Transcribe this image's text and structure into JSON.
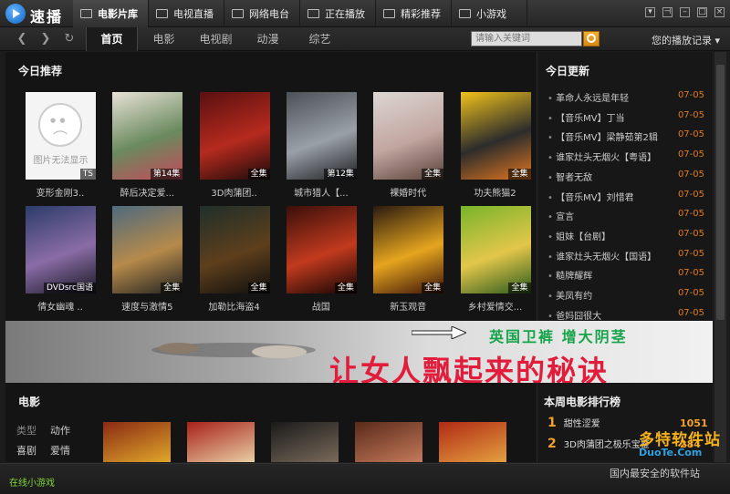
{
  "app": {
    "name": "速播"
  },
  "nav_tabs": [
    {
      "label": "电影片库",
      "active": true
    },
    {
      "label": "电视直播"
    },
    {
      "label": "网络电台"
    },
    {
      "label": "正在播放"
    },
    {
      "label": "精彩推荐"
    },
    {
      "label": "小游戏"
    }
  ],
  "toolbar": {
    "categories": [
      "首页",
      "电影",
      "电视剧",
      "动漫",
      "综艺"
    ],
    "active_category": "首页",
    "search_placeholder": "请输入关键词",
    "history_label": "您的播放记录 ▾"
  },
  "recommend": {
    "title": "今日推荐",
    "items": [
      {
        "title": "变形金刚3..",
        "badge": "TS",
        "no_image": true,
        "no_image_text": "图片无法显示"
      },
      {
        "title": "醉后决定爱...",
        "badge": "第14集",
        "colors": [
          "#e7e1d6",
          "#6a8a5e",
          "#c64a5a"
        ]
      },
      {
        "title": "3D肉蒲团..",
        "badge": "全集",
        "colors": [
          "#5a1010",
          "#b62a1e",
          "#1a0a0a"
        ]
      },
      {
        "title": "城市猎人【...",
        "badge": "第12集",
        "colors": [
          "#4c5057",
          "#9aa0a8",
          "#1e1f22"
        ]
      },
      {
        "title": "裸婚时代",
        "badge": "全集",
        "colors": [
          "#dcd6d2",
          "#c2a6a0",
          "#58423a"
        ]
      },
      {
        "title": "功夫熊猫2",
        "badge": "全集",
        "colors": [
          "#f1c21a",
          "#2c2c2c",
          "#e1761f"
        ]
      },
      {
        "title": "倩女幽魂 ..",
        "badge": "DVDsrc国语",
        "colors": [
          "#2c3c6a",
          "#8a6ca6",
          "#181824"
        ]
      },
      {
        "title": "速度与激情5",
        "badge": "全集",
        "colors": [
          "#4f6a7e",
          "#b68a4a",
          "#222"
        ]
      },
      {
        "title": "加勒比海盗4",
        "badge": "全集",
        "colors": [
          "#1f2f2a",
          "#5e3f1c",
          "#0e0e0e"
        ]
      },
      {
        "title": "战国",
        "badge": "全集",
        "colors": [
          "#3a0f0a",
          "#c23a1e",
          "#120404"
        ]
      },
      {
        "title": "新玉观音",
        "badge": "全集",
        "colors": [
          "#2a1a10",
          "#e6a51e",
          "#3a120a"
        ]
      },
      {
        "title": "乡村爱情交...",
        "badge": "全集",
        "colors": [
          "#78b42a",
          "#e3c64a",
          "#2a5a1c"
        ]
      }
    ]
  },
  "updates": {
    "title": "今日更新",
    "items": [
      {
        "title": "革命人永远是年轻",
        "date": "07-05"
      },
      {
        "title": "【音乐MV】丁当",
        "date": "07-05"
      },
      {
        "title": "【音乐MV】梁静茹第2辑",
        "date": "07-05"
      },
      {
        "title": "谁家灶头无烟火【粤语】",
        "date": "07-05"
      },
      {
        "title": "智者无敌",
        "date": "07-05"
      },
      {
        "title": "【音乐MV】刘惜君",
        "date": "07-05"
      },
      {
        "title": "宣言",
        "date": "07-05"
      },
      {
        "title": "姐妹【台剧】",
        "date": "07-05"
      },
      {
        "title": "谁家灶头无烟火【国语】",
        "date": "07-05"
      },
      {
        "title": "糙牌耀辉",
        "date": "07-05"
      },
      {
        "title": "美凤有约",
        "date": "07-05"
      },
      {
        "title": "爸妈囧很大",
        "date": "07-05"
      }
    ]
  },
  "banner": {
    "headline_top": "英国卫裤 增大阴茎",
    "headline_main": "让女人飘起来的秘诀"
  },
  "movies": {
    "title": "电影",
    "genres": [
      {
        "label": "类型",
        "dim": true
      },
      {
        "label": "动作"
      },
      {
        "label": "喜剧"
      },
      {
        "label": "爱情"
      }
    ],
    "posters": [
      {
        "colors": [
          "#8a2a14",
          "#e0a72a"
        ]
      },
      {
        "colors": [
          "#a8201a",
          "#e8cfa4"
        ]
      },
      {
        "colors": [
          "#1a1a1a",
          "#7a6a5a"
        ]
      },
      {
        "colors": [
          "#5a2a1a",
          "#c47a5a"
        ]
      },
      {
        "colors": [
          "#b02a14",
          "#e4a040"
        ]
      }
    ]
  },
  "weekly_rank": {
    "title": "本周电影排行榜",
    "items": [
      {
        "rank": "1",
        "title": "甜性涩爱",
        "score": "1051"
      },
      {
        "rank": "2",
        "title": "3D肉蒲团之极乐宝鉴",
        "score": "284"
      }
    ]
  },
  "watermark": {
    "brand": "多特软件站",
    "url": "DuoTe.Com",
    "slogan": "国内最安全的软件站"
  },
  "status": {
    "link": "在线小游戏"
  }
}
